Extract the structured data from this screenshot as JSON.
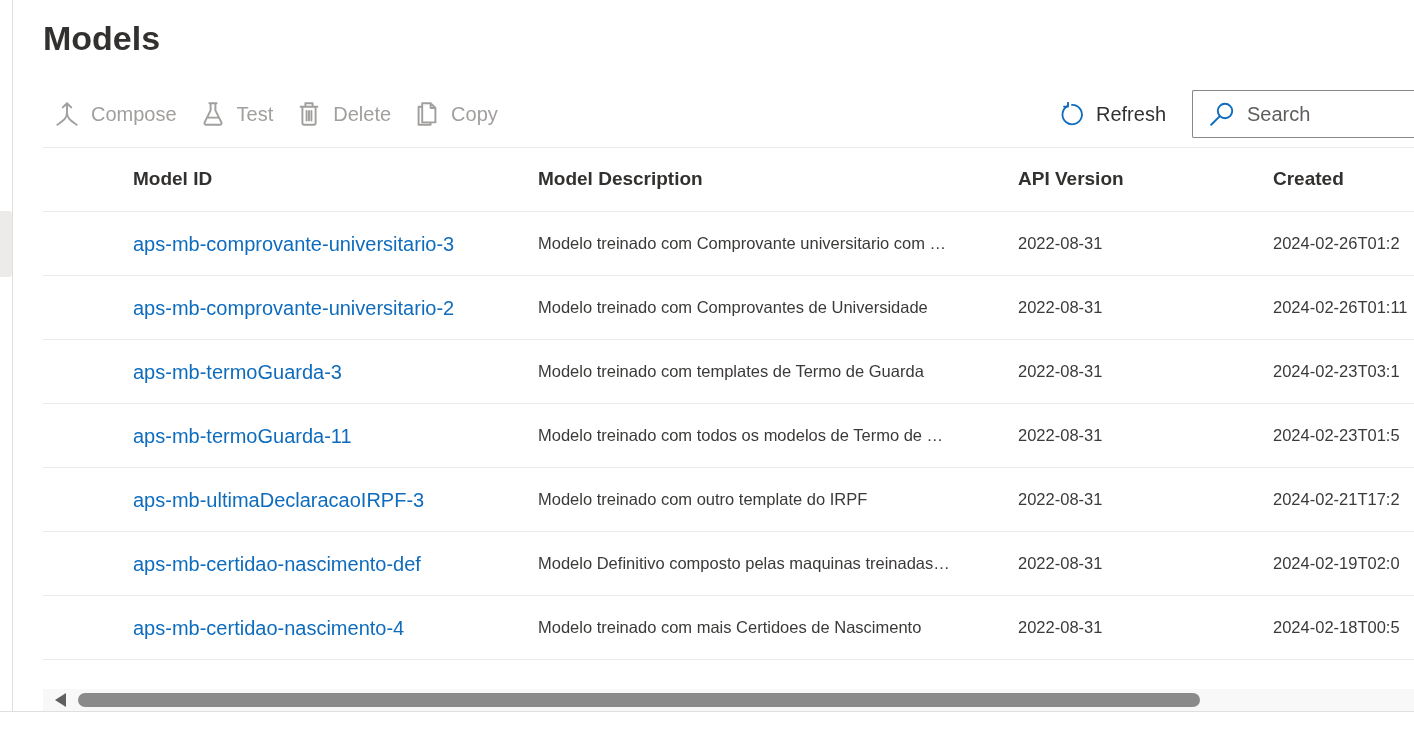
{
  "page": {
    "title": "Models"
  },
  "toolbar": {
    "commands": [
      {
        "label": "Compose",
        "disabled": true
      },
      {
        "label": "Test",
        "disabled": true
      },
      {
        "label": "Delete",
        "disabled": true
      },
      {
        "label": "Copy",
        "disabled": true
      }
    ],
    "refresh": {
      "label": "Refresh"
    },
    "search": {
      "placeholder": "Search"
    }
  },
  "table": {
    "columns": [
      "Model ID",
      "Model Description",
      "API Version",
      "Created"
    ],
    "rows": [
      {
        "model_id": "aps-mb-comprovante-universitario-3",
        "description": "Modelo treinado com Comprovante universitario com …",
        "api_version": "2022-08-31",
        "created": "2024-02-26T01:2"
      },
      {
        "model_id": "aps-mb-comprovante-universitario-2",
        "description": "Modelo treinado com Comprovantes de Universidade",
        "api_version": "2022-08-31",
        "created": "2024-02-26T01:11"
      },
      {
        "model_id": "aps-mb-termoGuarda-3",
        "description": "Modelo treinado com templates de Termo de Guarda",
        "api_version": "2022-08-31",
        "created": "2024-02-23T03:1"
      },
      {
        "model_id": "aps-mb-termoGuarda-11",
        "description": "Modelo treinado com todos os modelos de Termo de …",
        "api_version": "2022-08-31",
        "created": "2024-02-23T01:5"
      },
      {
        "model_id": "aps-mb-ultimaDeclaracaoIRPF-3",
        "description": "Modelo treinado com outro template do IRPF",
        "api_version": "2022-08-31",
        "created": "2024-02-21T17:2"
      },
      {
        "model_id": "aps-mb-certidao-nascimento-def",
        "description": "Modelo Definitivo composto pelas maquinas treinadas…",
        "api_version": "2022-08-31",
        "created": "2024-02-19T02:0"
      },
      {
        "model_id": "aps-mb-certidao-nascimento-4",
        "description": "Modelo treinado com mais Certidoes de Nascimento",
        "api_version": "2022-08-31",
        "created": "2024-02-18T00:5"
      }
    ]
  }
}
